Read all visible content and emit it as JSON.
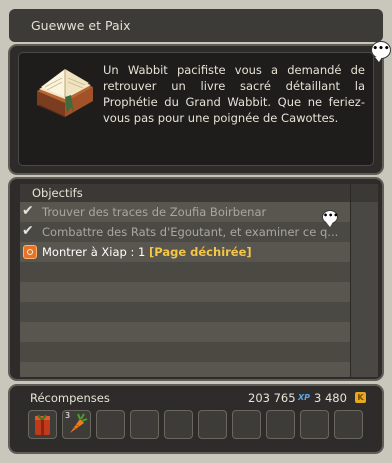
{
  "window": {
    "title": "Guewwe et Paix"
  },
  "description": {
    "text": "Un Wabbit pacifiste vous a demandé de retrouver un livre sacré détaillant la Prophétie du Grand Wabbit. Que ne feriez-vous pas pour une poignée de Cawottes.",
    "icon": "book-icon",
    "bubble_icon": "speech-bubble-icon"
  },
  "objectives": {
    "header": "Objectifs",
    "rows": [
      {
        "text": "Trouver des traces de Zoufia Boirbenar",
        "status": "done",
        "icon": "check-icon"
      },
      {
        "text": "Combattre des Rats d'Egoutant, et examiner ce q...",
        "status": "done",
        "icon": "check-icon"
      },
      {
        "prefix": "Montrer à Xiap : 1 ",
        "highlight": "[Page déchirée]",
        "status": "active",
        "icon": "target-icon"
      }
    ]
  },
  "rewards": {
    "label": "Récompenses",
    "xp": "203 765",
    "xp_unit": "XP",
    "kamas": "3 480",
    "kamas_icon": "K",
    "items": [
      {
        "icon": "red-package-icon",
        "qty": ""
      },
      {
        "icon": "carrot-icon",
        "qty": "3"
      }
    ],
    "empty_slot_count": 8
  },
  "colors": {
    "panel_bg": "#2d2c2a",
    "highlight": "#f2c648",
    "xp_blue": "#5aa7e8",
    "kamas_gold": "#e6a81e"
  }
}
